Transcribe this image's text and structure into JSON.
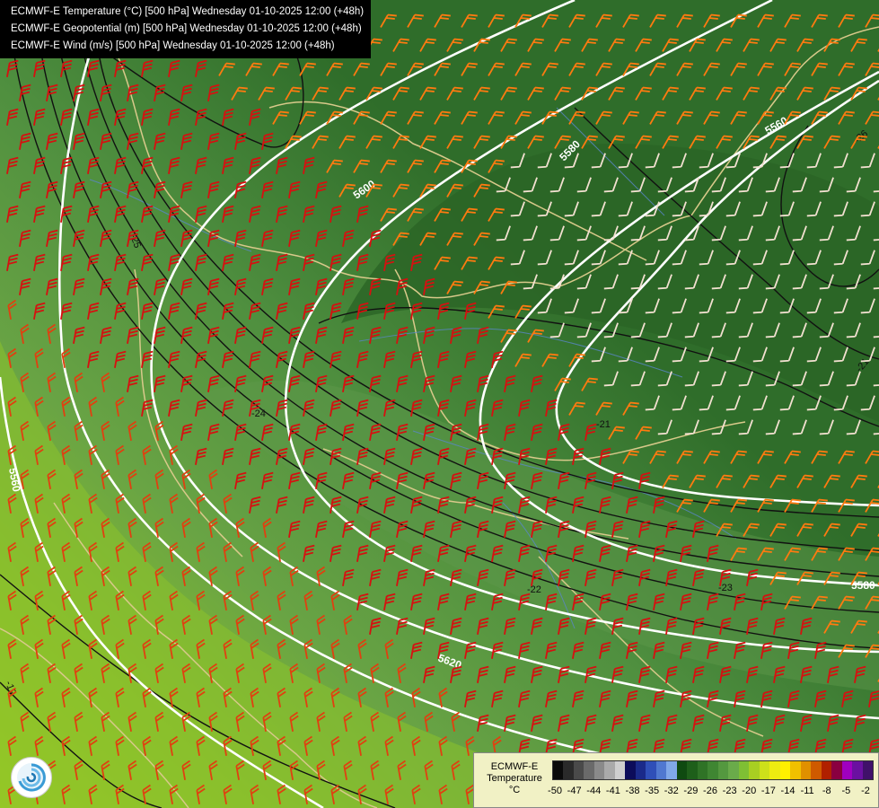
{
  "header": {
    "lines": [
      "ECMWF-E Temperature (°C) [500 hPa] Wednesday 01-10-2025 12:00 (+48h)",
      "ECMWF-E Geopotential (m) [500 hPa] Wednesday 01-10-2025 12:00 (+48h)",
      "ECMWF-E Wind (m/s) [500 hPa] Wednesday 01-10-2025 12:00 (+48h)"
    ]
  },
  "map": {
    "geopotential_labels": [
      "5600",
      "5580",
      "5560",
      "5560",
      "5580",
      "5620"
    ],
    "temperature_labels": [
      "-25",
      "-24",
      "-21",
      "-22",
      "-23",
      "-19",
      "-26",
      "-21"
    ]
  },
  "legend": {
    "title_line1": "ECMWF-E",
    "title_line2": "Temperature",
    "unit": "°C",
    "ticks": [
      "-50",
      "-47",
      "-44",
      "-41",
      "-38",
      "-35",
      "-32",
      "-29",
      "-26",
      "-23",
      "-20",
      "-17",
      "-14",
      "-11",
      "-8",
      "-5",
      "-2"
    ],
    "colors": [
      "#0a0a0a",
      "#2a2a2a",
      "#4a4a4a",
      "#6a6a6a",
      "#8a8a8a",
      "#aaaaaa",
      "#cfcfcf",
      "#0c0c5a",
      "#1a2a8a",
      "#2f4fb8",
      "#5078d0",
      "#80a8e8",
      "#0f4a10",
      "#1e5f1a",
      "#2f7326",
      "#3f8632",
      "#54983f",
      "#6aab4a",
      "#7fbf34",
      "#a8cf22",
      "#cde01a",
      "#eeec10",
      "#fff000",
      "#f0c000",
      "#e09000",
      "#cf5a00",
      "#b02000",
      "#8a0040",
      "#a000c0",
      "#6a10a0",
      "#40106a"
    ]
  },
  "logo": {
    "icon": "ecmwf-logo-icon"
  }
}
